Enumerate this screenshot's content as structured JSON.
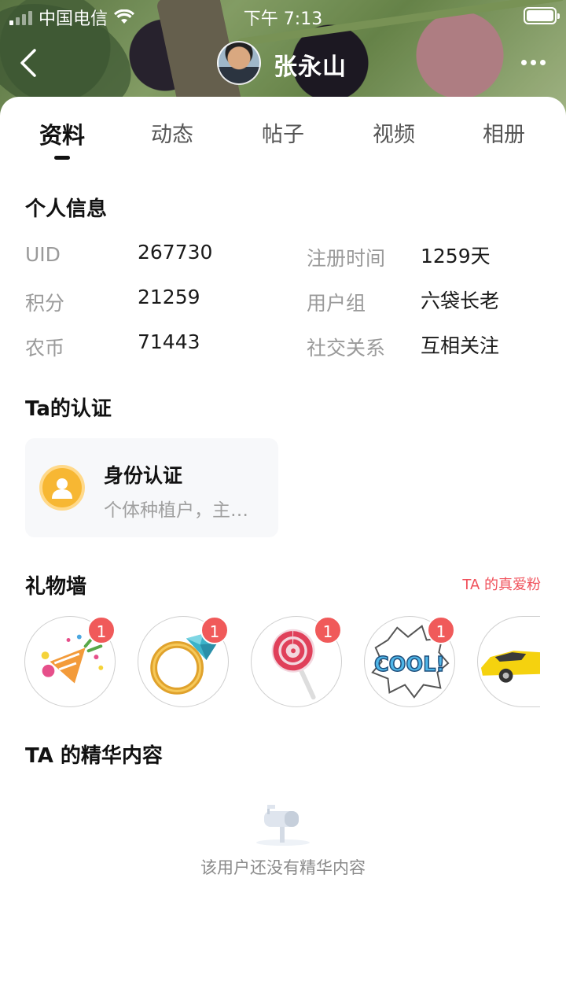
{
  "status_bar": {
    "carrier": "中国电信",
    "time": "下午 7:13"
  },
  "profile": {
    "name": "张永山"
  },
  "tabs": [
    {
      "label": "资料",
      "active": true
    },
    {
      "label": "动态",
      "active": false
    },
    {
      "label": "帖子",
      "active": false
    },
    {
      "label": "视频",
      "active": false
    },
    {
      "label": "相册",
      "active": false
    }
  ],
  "personal_info": {
    "title": "个人信息",
    "items": [
      {
        "label": "UID",
        "value": "267730"
      },
      {
        "label": "注册时间",
        "value": "1259天"
      },
      {
        "label": "积分",
        "value": "21259"
      },
      {
        "label": "用户组",
        "value": "六袋长老"
      },
      {
        "label": "农币",
        "value": "71443"
      },
      {
        "label": "社交关系",
        "value": "互相关注"
      }
    ]
  },
  "certification": {
    "title": "Ta的认证",
    "card_title": "身份认证",
    "card_desc": "个体种植户，主…",
    "icon": "user-icon"
  },
  "gift_wall": {
    "title": "礼物墙",
    "link": "TA 的真爱粉",
    "gifts": [
      {
        "icon": "party-popper-icon",
        "count": "1"
      },
      {
        "icon": "diamond-ring-icon",
        "count": "1"
      },
      {
        "icon": "lollipop-icon",
        "count": "1"
      },
      {
        "icon": "cool-sticker-icon",
        "count": "1"
      },
      {
        "icon": "sports-car-icon",
        "count": ""
      }
    ]
  },
  "featured": {
    "title": "TA 的精华内容",
    "empty_text": "该用户还没有精华内容",
    "icon": "mailbox-icon"
  },
  "colors": {
    "accent_red": "#f05a5a",
    "link_red": "#f0505a",
    "cert_yellow": "#f7b733"
  }
}
